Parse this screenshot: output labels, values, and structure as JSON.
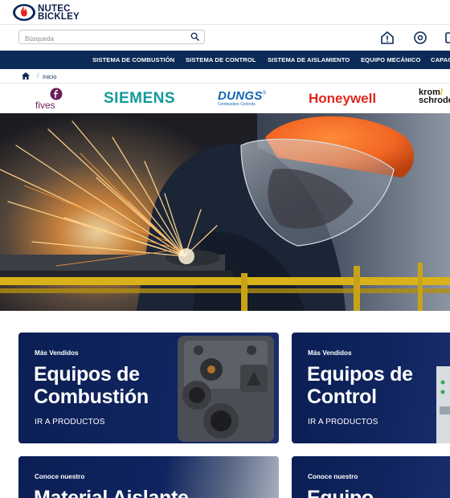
{
  "header": {
    "logo_line1": "NUTEC",
    "logo_line2": "BICKLEY"
  },
  "search": {
    "placeholder": "Búsqueda"
  },
  "nav": {
    "items": [
      "SISTEMA DE COMBUSTIÓN",
      "SISTEMA DE CONTROL",
      "SISTEMA DE AISLAMIENTO",
      "EQUIPO MECÁNICO",
      "CAPAC"
    ]
  },
  "breadcrumb": {
    "separator": "/",
    "current": "Inicio"
  },
  "brands": {
    "fives": "fives",
    "siemens": "SIEMENS",
    "dungs": "DUNGS",
    "dungs_reg": "®",
    "dungs_sub": "Combustion Controls",
    "honeywell": "Honeywell",
    "krom_line1": "krom",
    "krom_line2": "schrode"
  },
  "cards": [
    {
      "kicker": "Más Vendidos",
      "title_line1": "Equipos de",
      "title_line2": "Combustión",
      "cta": "IR A PRODUCTOS"
    },
    {
      "kicker": "Más Vendidos",
      "title_line1": "Equipos de",
      "title_line2": "Control",
      "cta": "IR A PRODUCTOS"
    },
    {
      "kicker": "Conoce nuestro",
      "title_line1": "Material Aislante",
      "title_line2": "",
      "cta": ""
    },
    {
      "kicker": "Conoce nuestro",
      "title_line1": "Equipo",
      "title_line2": "",
      "cta": ""
    }
  ],
  "colors": {
    "nav_bg": "#0b2a57",
    "card_bg": "#0b1f55",
    "siemens": "#129a9b",
    "honeywell": "#e1261c",
    "dungs": "#1565b5",
    "hero_orange": "#f26522"
  }
}
